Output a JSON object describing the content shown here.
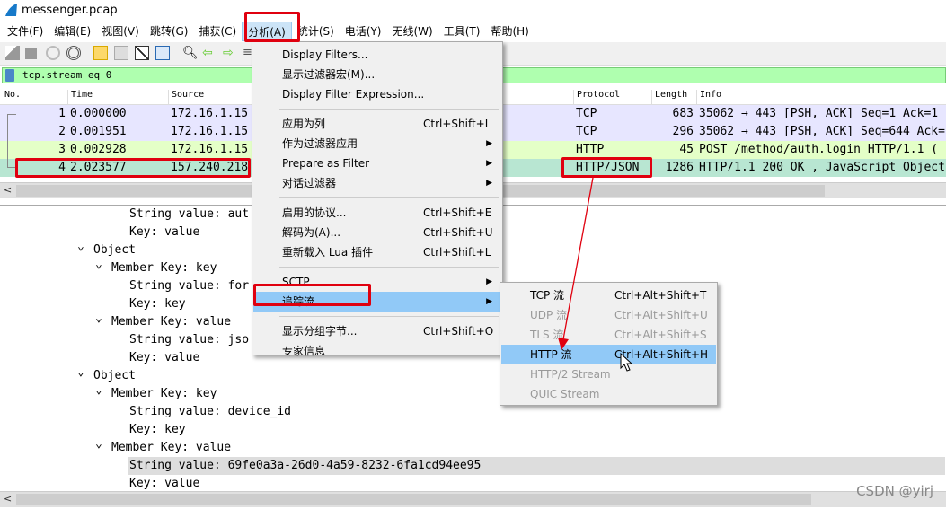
{
  "window": {
    "title": "messenger.pcap"
  },
  "menubar": [
    "文件(F)",
    "编辑(E)",
    "视图(V)",
    "跳转(G)",
    "捕获(C)",
    "分析(A)",
    "统计(S)",
    "电话(Y)",
    "无线(W)",
    "工具(T)",
    "帮助(H)"
  ],
  "filter": {
    "value": "tcp.stream eq 0"
  },
  "packet_list": {
    "columns": [
      "No.",
      "Time",
      "Source",
      "Protocol",
      "Length",
      "Info"
    ],
    "rows": [
      {
        "no": "1",
        "time": "0.000000",
        "source": "172.16.1.15",
        "protocol": "TCP",
        "length": "683",
        "info": "35062 → 443 [PSH, ACK] Seq=1 Ack=1",
        "color": "#e7e6ff"
      },
      {
        "no": "2",
        "time": "0.001951",
        "source": "172.16.1.15",
        "protocol": "TCP",
        "length": "296",
        "info": "35062 → 443 [PSH, ACK] Seq=644 Ack=",
        "color": "#e7e6ff"
      },
      {
        "no": "3",
        "time": "0.002928",
        "source": "172.16.1.15",
        "protocol": "HTTP",
        "length": "45",
        "info": "POST /method/auth.login HTTP/1.1  (",
        "color": "#e4ffc7"
      },
      {
        "no": "4",
        "time": "2.023577",
        "source": "157.240.218",
        "protocol": "HTTP/JSON",
        "length": "1286",
        "info": "HTTP/1.1 200 OK , JavaScript Object",
        "color": "#b8e6d2"
      }
    ]
  },
  "details": [
    {
      "text": "String value: aut",
      "indent": 3
    },
    {
      "text": "Key: value",
      "indent": 3
    },
    {
      "text": "Object",
      "indent": 1,
      "expander": "⌄"
    },
    {
      "text": "Member Key: key",
      "indent": 2,
      "expander": "⌄"
    },
    {
      "text": "String value: for",
      "indent": 3
    },
    {
      "text": "Key: key",
      "indent": 3
    },
    {
      "text": "Member Key: value",
      "indent": 2,
      "expander": "⌄"
    },
    {
      "text": "String value: jso",
      "indent": 3
    },
    {
      "text": "Key: value",
      "indent": 3
    },
    {
      "text": "Object",
      "indent": 1,
      "expander": "⌄"
    },
    {
      "text": "Member Key: key",
      "indent": 2,
      "expander": "⌄"
    },
    {
      "text": "String value: device_id",
      "indent": 3
    },
    {
      "text": "Key: key",
      "indent": 3
    },
    {
      "text": "Member Key: value",
      "indent": 2,
      "expander": "⌄"
    },
    {
      "text": "String value: 69fe0a3a-26d0-4a59-8232-6fa1cd94ee95",
      "indent": 3,
      "selected": true
    },
    {
      "text": "Key: value",
      "indent": 3
    }
  ],
  "analyze_menu": [
    {
      "label": "Display Filters..."
    },
    {
      "label": "显示过滤器宏(M)..."
    },
    {
      "label": "Display Filter Expression..."
    },
    {
      "separator": true
    },
    {
      "label": "应用为列",
      "shortcut": "Ctrl+Shift+I"
    },
    {
      "label": "作为过滤器应用",
      "submenu": true
    },
    {
      "label": "Prepare as Filter",
      "submenu": true
    },
    {
      "label": "对话过滤器",
      "submenu": true
    },
    {
      "separator": true
    },
    {
      "label": "启用的协议...",
      "shortcut": "Ctrl+Shift+E"
    },
    {
      "label": "解码为(A)...",
      "shortcut": "Ctrl+Shift+U"
    },
    {
      "label": "重新载入 Lua 插件",
      "shortcut": "Ctrl+Shift+L"
    },
    {
      "separator": true
    },
    {
      "label": "SCTP",
      "submenu": true
    },
    {
      "label": "追踪流",
      "submenu": true,
      "highlighted": true
    },
    {
      "separator": true
    },
    {
      "label": "显示分组字节...",
      "shortcut": "Ctrl+Shift+O"
    },
    {
      "label": "专家信息"
    }
  ],
  "follow_submenu": [
    {
      "label": "TCP 流",
      "shortcut": "Ctrl+Alt+Shift+T"
    },
    {
      "label": "UDP 流",
      "shortcut": "Ctrl+Alt+Shift+U",
      "disabled": true
    },
    {
      "label": "TLS 流",
      "shortcut": "Ctrl+Alt+Shift+S",
      "disabled": true
    },
    {
      "label": "HTTP 流",
      "shortcut": "Ctrl+Alt+Shift+H",
      "highlighted": true
    },
    {
      "label": "HTTP/2 Stream",
      "disabled": true
    },
    {
      "label": "QUIC Stream",
      "disabled": true
    }
  ],
  "annotation_color": "#e0000f",
  "watermark": "CSDN @yirj"
}
